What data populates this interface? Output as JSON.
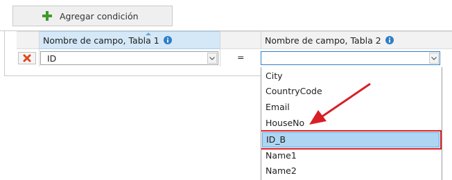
{
  "toolbar": {
    "add_condition_label": "Agregar condición",
    "add_icon": "plus-icon"
  },
  "grid": {
    "columns": [
      {
        "label": "Nombre de campo, Tabla 1",
        "icon": "info-icon",
        "sorted": true
      },
      {
        "label": "Nombre de campo, Tabla 2",
        "icon": "info-icon",
        "sorted": false
      }
    ],
    "rows": [
      {
        "delete_icon": "delete-x-icon",
        "field1": "ID",
        "operator": "=",
        "field2": ""
      }
    ]
  },
  "dropdown": {
    "options": [
      "City",
      "CountryCode",
      "Email",
      "HouseNo",
      "ID_B",
      "Name1",
      "Name2"
    ],
    "highlighted": "ID_B"
  },
  "colors": {
    "accent": "#2f7ec7",
    "highlight_bg": "#aed6f2",
    "annotation_red": "#d81f26",
    "add_icon_green": "#3e9a2b"
  }
}
